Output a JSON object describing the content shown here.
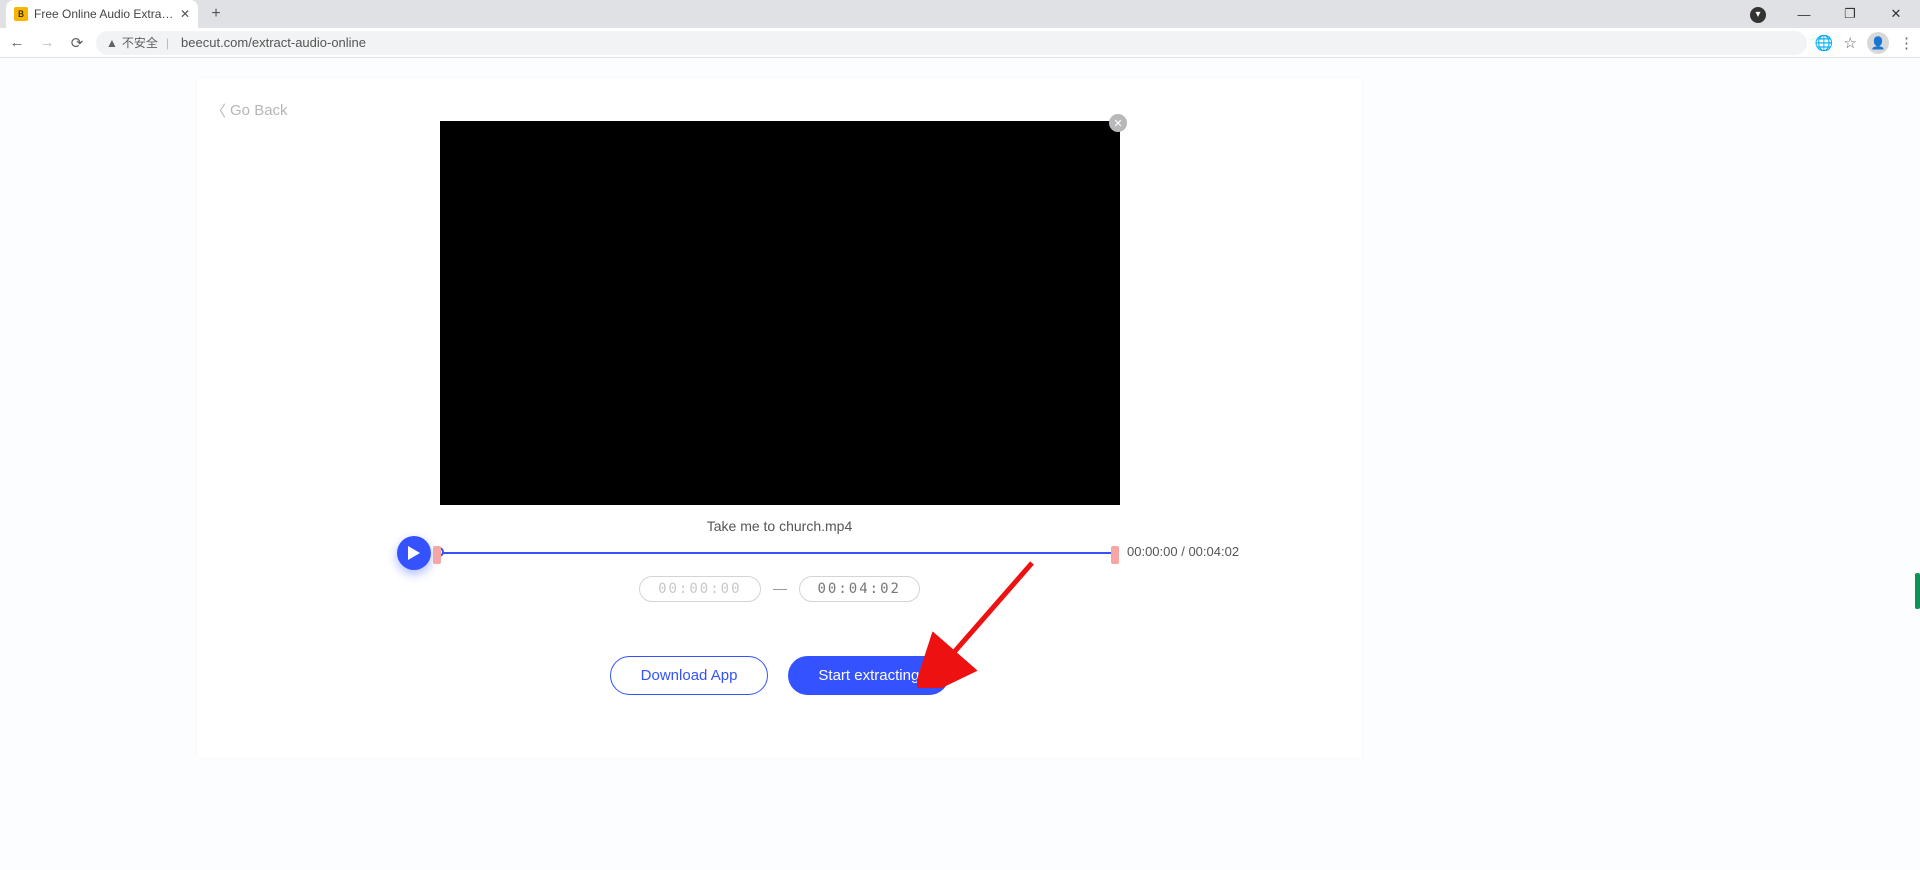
{
  "browser": {
    "tab_title": "Free Online Audio Extractor - E",
    "security_text": "不安全",
    "url": "beecut.com/extract-audio-online"
  },
  "nav": {
    "go_back_label": "Go Back"
  },
  "video": {
    "filename": "Take me to church.mp4"
  },
  "timeline": {
    "time_current": "00:00:00",
    "time_total": "00:04:02",
    "separator": " / ",
    "start_time": "00:00:00",
    "end_time": "00:04:02"
  },
  "buttons": {
    "download_app": "Download App",
    "start_extracting": "Start extracting"
  }
}
